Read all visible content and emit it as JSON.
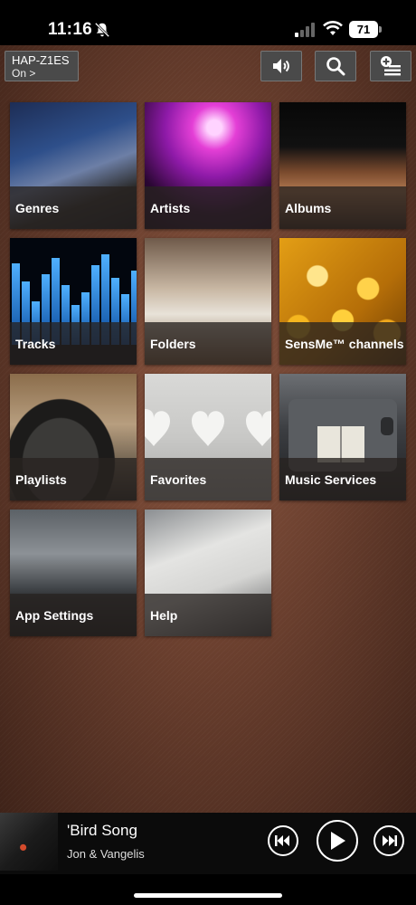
{
  "status_bar": {
    "time": "11:16",
    "battery": "71",
    "icons": [
      "bell-muted-icon",
      "signal-icon",
      "wifi-icon",
      "battery-icon"
    ]
  },
  "toolbar": {
    "device_name": "HAP-Z1ES",
    "device_status": "On >",
    "buttons": [
      "volume-icon",
      "search-icon",
      "add-queue-icon"
    ]
  },
  "tiles": [
    {
      "label": "Genres"
    },
    {
      "label": "Artists"
    },
    {
      "label": "Albums"
    },
    {
      "label": "Tracks"
    },
    {
      "label": "Folders"
    },
    {
      "label": "SensMe™ channels"
    },
    {
      "label": "Playlists"
    },
    {
      "label": "Favorites"
    },
    {
      "label": "Music Services"
    },
    {
      "label": "App Settings"
    },
    {
      "label": "Help"
    }
  ],
  "now_playing": {
    "title": "'Bird Song",
    "artist": "Jon & Vangelis",
    "controls": [
      "previous-icon",
      "play-icon",
      "next-icon"
    ]
  },
  "colors": {
    "background": "#6a3f2e",
    "button_bg": "#4a4a4a",
    "label_bar": "#282220"
  }
}
